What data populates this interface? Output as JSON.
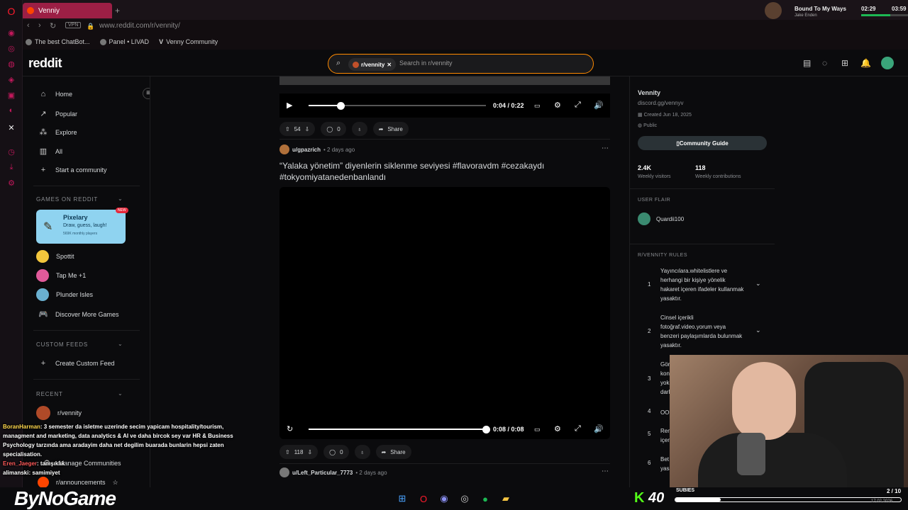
{
  "browser": {
    "tab_title": "Venniy",
    "tab_new": "+",
    "url": "www.reddit.com/r/vennity/",
    "vpn_label": "VPN",
    "bookmarks": [
      "The best ChatBot...",
      "Panel • LIVAD",
      "Venny Community"
    ]
  },
  "now_playing": {
    "title": "Bound To My Ways",
    "artist": "Jake Enden",
    "time_left": "02:29",
    "time_right": "03:59",
    "progress": 0.62
  },
  "reddit": {
    "logo": "reddit",
    "search_chip": "r/vennity",
    "search_placeholder": "Search in r/vennity"
  },
  "leftnav": {
    "items": [
      "Home",
      "Popular",
      "Explore",
      "All",
      "Start a community"
    ],
    "games_header": "GAMES ON REDDIT",
    "pixelary": {
      "title": "Pixelary",
      "subtitle": "Draw, guess, laugh!",
      "players": "569K monthly players",
      "badge": "NEW"
    },
    "games": [
      "Spottit",
      "Tap Me +1",
      "Plunder Isles",
      "Discover More Games"
    ],
    "custom_header": "CUSTOM FEEDS",
    "create_feed": "Create Custom Feed",
    "recent_header": "RECENT",
    "recent": [
      "r/vennity"
    ],
    "manage": "Manage Communities",
    "announcements": "r/announcements"
  },
  "post1": {
    "time": "0:04 / 0:22",
    "progress": 0.18,
    "votes": "54",
    "comments": "0",
    "share": "Share"
  },
  "post2": {
    "user": "u/gpazrich",
    "age": "• 2 days ago",
    "title": "“Yalaka yönetim” diyenlerin siklenme seviyesi #flavoravdm #cezakaydı #tokyomiyatanedenbanlandı",
    "time": "0:08 / 0:08",
    "votes": "118",
    "comments": "0",
    "share": "Share"
  },
  "post3": {
    "user": "u/Left_Particular_7773",
    "age": "• 2 days ago"
  },
  "sidebar": {
    "name": "Vennity",
    "desc": "discord.gg/vennyv",
    "created": "Created Jun 18, 2025",
    "visibility": "Public",
    "guide": "Community Guide",
    "visitors": "2.4K",
    "visitors_label": "Weekly visitors",
    "contributions": "118",
    "contributions_label": "Weekly contributions",
    "flair_header": "USER FLAIR",
    "flair_user": "Quardii100",
    "rules_header": "R/VENNITY RULES",
    "rules": [
      {
        "num": "1",
        "text": "Yayıncılara.whitelistlere ve herhangi bir kişiye yönelik hakaret içeren ifadeler kullanmak yasaktır."
      },
      {
        "num": "2",
        "text": "Cinsel içerikli fotoğraf.video.yorum veya benzeri paylaşımlarda bulunmak yasaktır."
      },
      {
        "num": "3",
        "text": "Gör kon yok. darl"
      },
      {
        "num": "4",
        "text": "OOC"
      },
      {
        "num": "5",
        "text": "Ren içer"
      },
      {
        "num": "6",
        "text": "Bet yasa"
      }
    ]
  },
  "chat": [
    {
      "user": "BoranHarman",
      "text": ": 3 semester da isletme uzerinde secim yapicam hospitality/tourism, managment and marketing, data analytics & AI ve daha bircok sey var HR & Business Psychology tarzında ama aradayim daha net degilim buarada bunlarin hepsi zaten specialisation."
    },
    {
      "user": "Eren_Jaeger",
      "text": ": tanışıklık"
    },
    {
      "user": "alimanski",
      "text": ": samimiyet"
    }
  ],
  "taskbar": {
    "brand": "ByNoGame",
    "kick_count": "40",
    "subies_label": "SUBIES",
    "subies_count": "2 / 10",
    "subies_progress": 0.2,
    "date": "17.02.2026"
  }
}
